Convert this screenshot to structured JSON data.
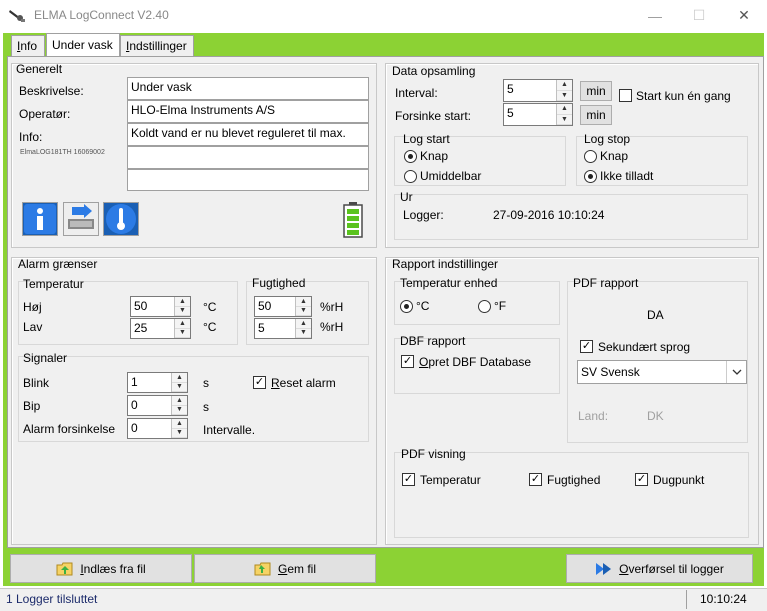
{
  "window": {
    "title": "ELMA LogConnect V2.40",
    "minimize": "—",
    "maximize": "☐",
    "close": "✕"
  },
  "tabs": [
    {
      "label_underline": "I",
      "label_rest": "nfo"
    },
    {
      "label": "Under vask"
    },
    {
      "label_underline": "I",
      "label_rest": "ndstillinger"
    }
  ],
  "generelt": {
    "title": "Generelt",
    "beskrivelse_label": "Beskrivelse:",
    "beskrivelse": "Under vask",
    "operator_label": "Operatør:",
    "operator": "HLO-Elma Instruments A/S",
    "info_label": "Info:",
    "info": "Koldt vand er nu blevet reguleret til max.",
    "device_id": "ElmaLOG181TH 16069002",
    "info_line2": "",
    "info_line3": ""
  },
  "data_opsamling": {
    "title": "Data opsamling",
    "interval_label": "Interval:",
    "interval": "5",
    "interval_unit": "min",
    "start_once": "Start kun én gang",
    "delay_label": "Forsinke start:",
    "delay": "5",
    "delay_unit": "min",
    "log_start_title": "Log start",
    "log_start_opt1": "Knap",
    "log_start_opt2": "Umiddelbar",
    "log_stop_title": "Log stop",
    "log_stop_opt1": "Knap",
    "log_stop_opt2": "Ikke tilladt",
    "ur_title": "Ur",
    "logger_label": "Logger:",
    "logger_time": "27-09-2016 10:10:24"
  },
  "alarm": {
    "title": "Alarm grænser",
    "temp_title": "Temperatur",
    "hoj_label": "Høj",
    "hoj": "50",
    "lav_label": "Lav",
    "lav": "25",
    "celsius": "°C",
    "fugt_title": "Fugtighed",
    "fugt_hoj": "50",
    "fugt_lav": "5",
    "rh": "%rH",
    "signaler_title": "Signaler",
    "blink_label": "Blink",
    "blink": "1",
    "bip_label": "Bip",
    "bip": "0",
    "sec": "s",
    "reset_underline": "R",
    "reset_rest": "eset  alarm",
    "forsinkelse_label": "Alarm forsinkelse",
    "forsinkelse": "0",
    "intervalle": "Intervalle."
  },
  "rapport": {
    "title": "Rapport indstillinger",
    "temp_enhed_title": "Temperatur enhed",
    "celsius": "°C",
    "fahrenheit": "°F",
    "dbf_title": "DBF rapport",
    "dbf_underline": "O",
    "dbf_rest": "pret DBF Database",
    "pdf_title": "PDF rapport",
    "pdf_lang": "DA",
    "sekundaert": "Sekundært sprog",
    "sprog_select": "SV Svensk",
    "land_label": "Land:",
    "land": "DK",
    "pdf_visning_title": "PDF visning",
    "vis_temp": "Temperatur",
    "vis_fugt": "Fugtighed",
    "vis_dug": "Dugpunkt"
  },
  "bottom": {
    "load_underline": "I",
    "load_rest": "ndlæs fra fil",
    "save_underline": "G",
    "save_rest": "em fil",
    "transfer_underline": "O",
    "transfer_rest": "verførsel til logger"
  },
  "status": {
    "message": "1 Logger tilsluttet",
    "time": "10:10:24"
  },
  "colors": {
    "accent_green": "#8cd234",
    "panel_bg": "#f0f0f0"
  }
}
